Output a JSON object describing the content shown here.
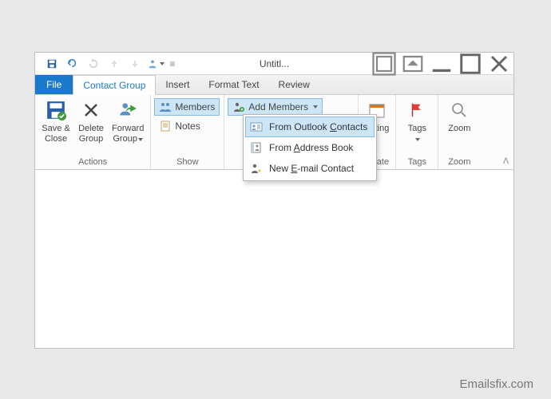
{
  "window": {
    "title": "Untitl..."
  },
  "tabs": {
    "file": "File",
    "contact_group": "Contact Group",
    "insert": "Insert",
    "format_text": "Format Text",
    "review": "Review"
  },
  "ribbon": {
    "actions": {
      "label": "Actions",
      "save_close": "Save &\nClose",
      "delete_group": "Delete\nGroup",
      "forward_group": "Forward\nGroup"
    },
    "show": {
      "label": "Show",
      "members": "Members",
      "notes": "Notes"
    },
    "add_members": {
      "button": "Add Members",
      "from_contacts_pre": "From Outlook ",
      "from_contacts_u": "C",
      "from_contacts_post": "ontacts",
      "from_addr_pre": "From ",
      "from_addr_u": "A",
      "from_addr_post": "ddress Book",
      "new_email_pre": "New ",
      "new_email_u": "E",
      "new_email_post": "-mail Contact"
    },
    "communicate": {
      "meeting": "eeting",
      "label": "nicate"
    },
    "tags": {
      "label": "Tags",
      "btn": "Tags"
    },
    "zoom": {
      "label": "Zoom",
      "btn": "Zoom"
    }
  },
  "watermark": "Emailsfix.com"
}
